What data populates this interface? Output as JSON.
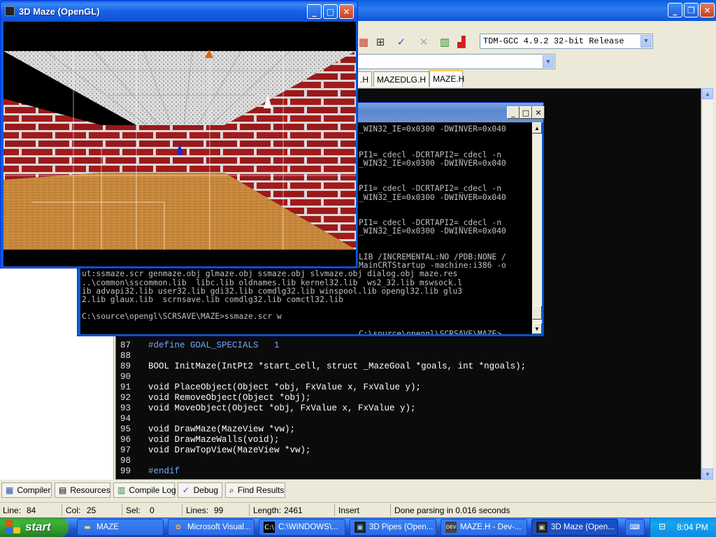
{
  "ide": {
    "compiler": "TDM-GCC 4.9.2 32-bit Release",
    "tabs": [
      ".H",
      "MAZEDLG.H",
      "MAZE.H"
    ],
    "code_lines": [
      {
        "num": "87",
        "text": "#define GOAL_SPECIALS   1"
      },
      {
        "num": "88",
        "text": ""
      },
      {
        "num": "89",
        "text": "BOOL InitMaze(IntPt2 *start_cell, struct _MazeGoal *goals, int *ngoals);"
      },
      {
        "num": "90",
        "text": ""
      },
      {
        "num": "91",
        "text": "void PlaceObject(Object *obj, FxValue x, FxValue y);"
      },
      {
        "num": "92",
        "text": "void RemoveObject(Object *obj);"
      },
      {
        "num": "93",
        "text": "void MoveObject(Object *obj, FxValue x, FxValue y);"
      },
      {
        "num": "94",
        "text": ""
      },
      {
        "num": "95",
        "text": "void DrawMaze(MazeView *vw);"
      },
      {
        "num": "96",
        "text": "void DrawMazeWalls(void);"
      },
      {
        "num": "97",
        "text": "void DrawTopView(MazeView *vw);"
      },
      {
        "num": "98",
        "text": ""
      },
      {
        "num": "99",
        "text": "#endif"
      }
    ],
    "bottom_tabs": [
      "Compiler",
      "Resources",
      "Compile Log",
      "Debug",
      "Find Results"
    ],
    "status": {
      "line_label": "Line:",
      "line_value": "84",
      "col_label": "Col:",
      "col_value": "25",
      "sel_label": "Sel:",
      "sel_value": "0",
      "lines_label": "Lines:",
      "lines_value": "99",
      "length_label": "Length:",
      "length_value": "2461",
      "mode": "Insert",
      "message": "Done parsing in 0.016 seconds"
    }
  },
  "console": {
    "lines": [
      "_WIN32_IE=0x0300 -DWINVER=0x040",
      "",
      "",
      "PI1=_cdecl -DCRTAPI2=_cdecl -n",
      "_WIN32_IE=0x0300 -DWINVER=0x040",
      "",
      "",
      "PI1=_cdecl -DCRTAPI2=_cdecl -n",
      "_WIN32_IE=0x0300 -DWINVER=0x040",
      "",
      "",
      "PI1=_cdecl -DCRTAPI2=_cdecl -n",
      "_WIN32_IE=0x0300 -DWINVER=0x040",
      "",
      "",
      "LIB /INCREMENTAL:NO /PDB:NONE /",
      "MainCRTStartup -machine:i386 -o",
      "ut:ssmaze.scr genmaze.obj glmaze.obj ssmaze.obj slvmaze.obj dialog.obj maze.res",
      "..\\common\\sscommon.lib  libc.lib oldnames.lib kernel32.lib  ws2_32.lib mswsock.l",
      "ib advapi32.lib user32.lib gdi32.lib comdlg32.lib winspool.lib opengl32.lib glu3",
      "2.lib glaux.lib  scrnsave.lib comdlg32.lib comctl32.lib",
      "",
      "C:\\source\\opengl\\SCRSAVE\\MAZE>ssmaze.scr w",
      "",
      "C:\\source\\opengl\\SCRSAVE\\MAZE>"
    ]
  },
  "maze_window": {
    "title": "3D Maze (OpenGL)"
  },
  "taskbar": {
    "start_label": "start",
    "tasks": [
      {
        "label": "MAZE",
        "icon": "folder-icon"
      },
      {
        "label": "Microsoft Visual...",
        "icon": "visual-studio-icon"
      },
      {
        "label": "C:\\WINDOWS\\...",
        "icon": "cmd-icon"
      },
      {
        "label": "3D Pipes (Open...",
        "icon": "pipes-icon"
      },
      {
        "label": "MAZE.H - Dev-...",
        "icon": "devcpp-icon"
      },
      {
        "label": "3D Maze (Open...",
        "icon": "maze-icon"
      }
    ],
    "clock": "8:04 PM"
  }
}
